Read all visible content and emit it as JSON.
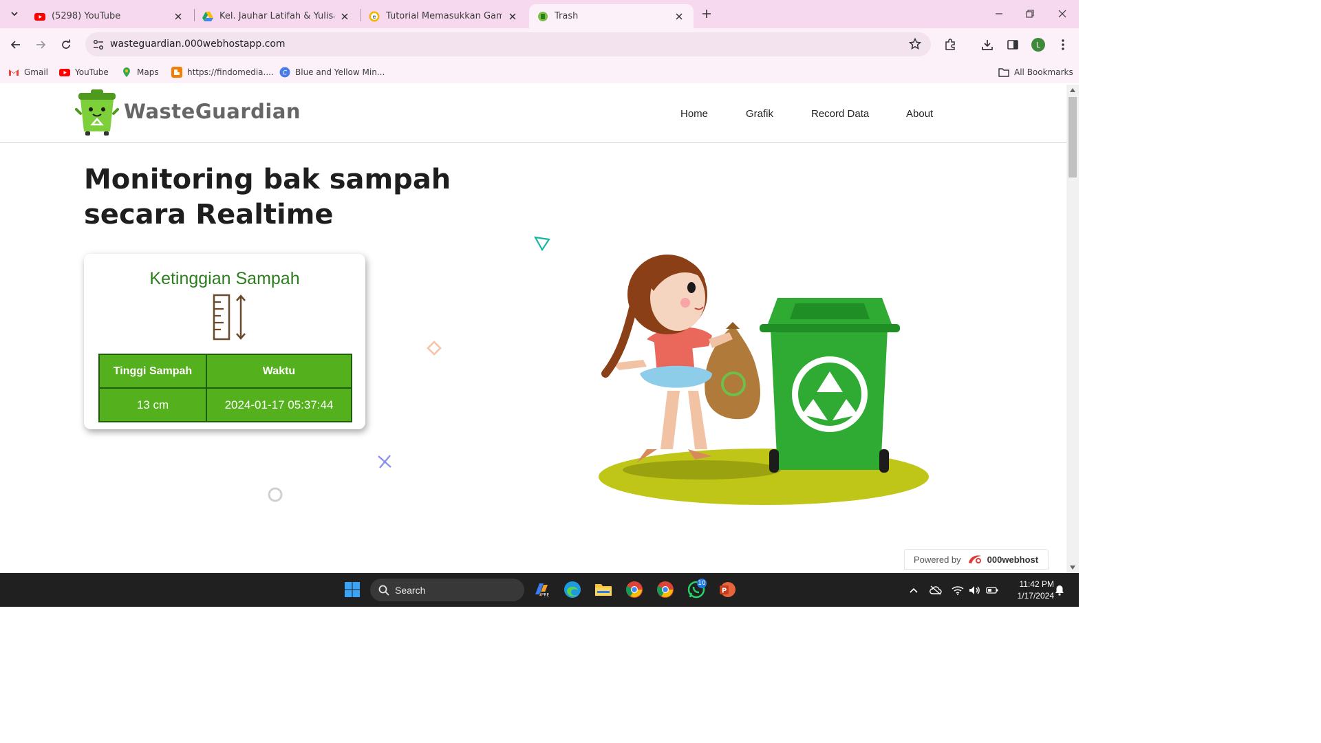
{
  "browser": {
    "tabs": [
      {
        "title": "(5298) YouTube",
        "icon": "youtube-icon",
        "active": false
      },
      {
        "title": "Kel. Jauhar Latifah & Yulisa Sury",
        "icon": "google-drive-icon",
        "active": false
      },
      {
        "title": "Tutorial Memasukkan Gambar F",
        "icon": "site-e-icon",
        "active": false
      },
      {
        "title": "Trash",
        "icon": "trash-favicon",
        "active": true
      }
    ],
    "url": "wasteguardian.000webhostapp.com",
    "profile_initial": "L",
    "bookmarks": [
      {
        "label": "Gmail",
        "icon": "gmail-icon"
      },
      {
        "label": "YouTube",
        "icon": "youtube-icon"
      },
      {
        "label": "Maps",
        "icon": "maps-icon"
      },
      {
        "label": "https://findomedia....",
        "icon": "blogger-icon"
      },
      {
        "label": "Blue and Yellow Min...",
        "icon": "canva-icon"
      }
    ],
    "all_bookmarks": "All Bookmarks"
  },
  "site": {
    "brand": "WasteGuardian",
    "nav": [
      "Home",
      "Grafik",
      "Record Data",
      "About"
    ],
    "hero_title_line1": "Monitoring bak sampah",
    "hero_title_line2": "secara Realtime",
    "card": {
      "title": "Ketinggian Sampah",
      "icon": "ruler-height-icon",
      "columns": [
        "Tinggi Sampah",
        "Waktu"
      ],
      "rows": [
        [
          "13 cm",
          "2024-01-17 05:37:44"
        ]
      ]
    },
    "powered_by": "Powered by",
    "powered_brand": "000webhost",
    "colors": {
      "accent_green": "#54b01d",
      "title_green": "#2d7d1e",
      "table_border": "#1f5c0a"
    }
  },
  "taskbar": {
    "search_label": "Search",
    "time": "11:42 PM",
    "date": "1/17/2024",
    "whatsapp_badge": "10"
  }
}
